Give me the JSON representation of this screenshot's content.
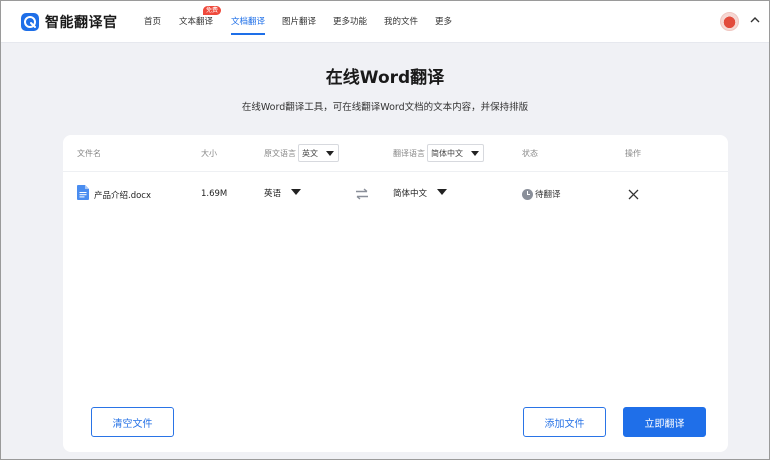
{
  "header": {
    "logo_text": "智能翻译官",
    "nav": [
      {
        "label": "首页"
      },
      {
        "label": "文本翻译"
      },
      {
        "label": "文档翻译"
      },
      {
        "label": "图片翻译"
      },
      {
        "label": "更多功能"
      },
      {
        "label": "我的文件"
      },
      {
        "label": "更多"
      }
    ],
    "nav_badge": "免费",
    "active_nav": "文档翻译"
  },
  "page": {
    "title": "在线Word翻译",
    "subtitle": "在线Word翻译工具，可在线翻译Word文档的文本内容，并保持排版"
  },
  "table": {
    "headers": {
      "filename": "文件名",
      "size": "大小",
      "source_lang": "原文语言",
      "target_lang": "翻译语言",
      "status": "状态",
      "action": "操作"
    },
    "source_lang_selected": "英文",
    "target_lang_selected": "简体中文",
    "rows": [
      {
        "filename": "产品介绍.docx",
        "size": "1.69M",
        "source_lang": "英语",
        "target_lang": "简体中文",
        "status": "待翻译"
      }
    ]
  },
  "buttons": {
    "clear": "清空文件",
    "add": "添加文件",
    "translate": "立即翻译"
  },
  "colors": {
    "accent": "#1e6fe8",
    "badge": "#ef4a3c",
    "background": "#f0f1f5"
  }
}
